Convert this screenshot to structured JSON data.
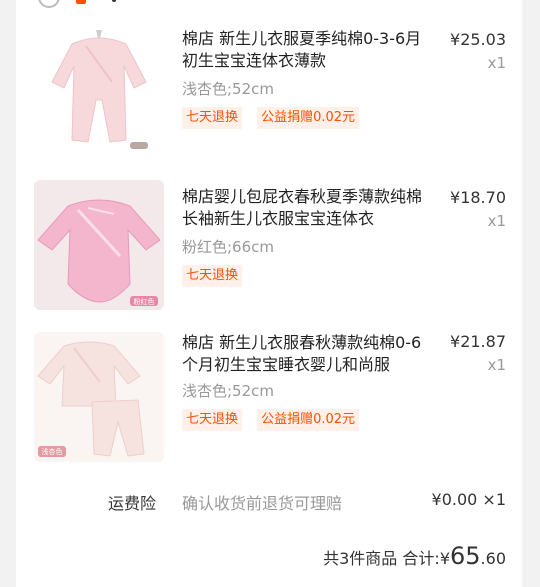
{
  "items": [
    {
      "title": "棉店 新生儿衣服夏季纯棉0-3-6月初生宝宝连体衣薄款",
      "sku": "浅杏色;52cm",
      "price": "¥25.03",
      "qty": "x1",
      "tags": [
        "七天退换",
        "公益捐赠0.02元"
      ],
      "thumb_color": "#f6d8da"
    },
    {
      "title": "棉店婴儿包屁衣春秋夏季薄款纯棉长袖新生儿衣服宝宝连体衣",
      "sku": "粉红色;66cm",
      "price": "¥18.70",
      "qty": "x1",
      "tags": [
        "七天退换"
      ],
      "thumb_color": "#f3b6cc",
      "thumb_badge": "粉红色"
    },
    {
      "title": "棉店 新生儿衣服春秋薄款纯棉0-6个月初生宝宝睡衣婴儿和尚服",
      "sku": "浅杏色;52cm",
      "price": "¥21.87",
      "qty": "x1",
      "tags": [
        "七天退换",
        "公益捐赠0.02元"
      ],
      "thumb_color": "#f6e2df",
      "thumb_badge": "浅杏色"
    }
  ],
  "insurance": {
    "label": "运费险",
    "desc": "确认收货前退货可理赔",
    "price": "¥0.00 ×1"
  },
  "summary": {
    "count_text": "共3件商品",
    "total_label": "合计:",
    "currency": "¥",
    "total_int": "65",
    "total_dec": ".60"
  },
  "colors": {
    "accent": "#ff5000",
    "tag_bg": "#fff1ea",
    "muted": "#999999"
  }
}
